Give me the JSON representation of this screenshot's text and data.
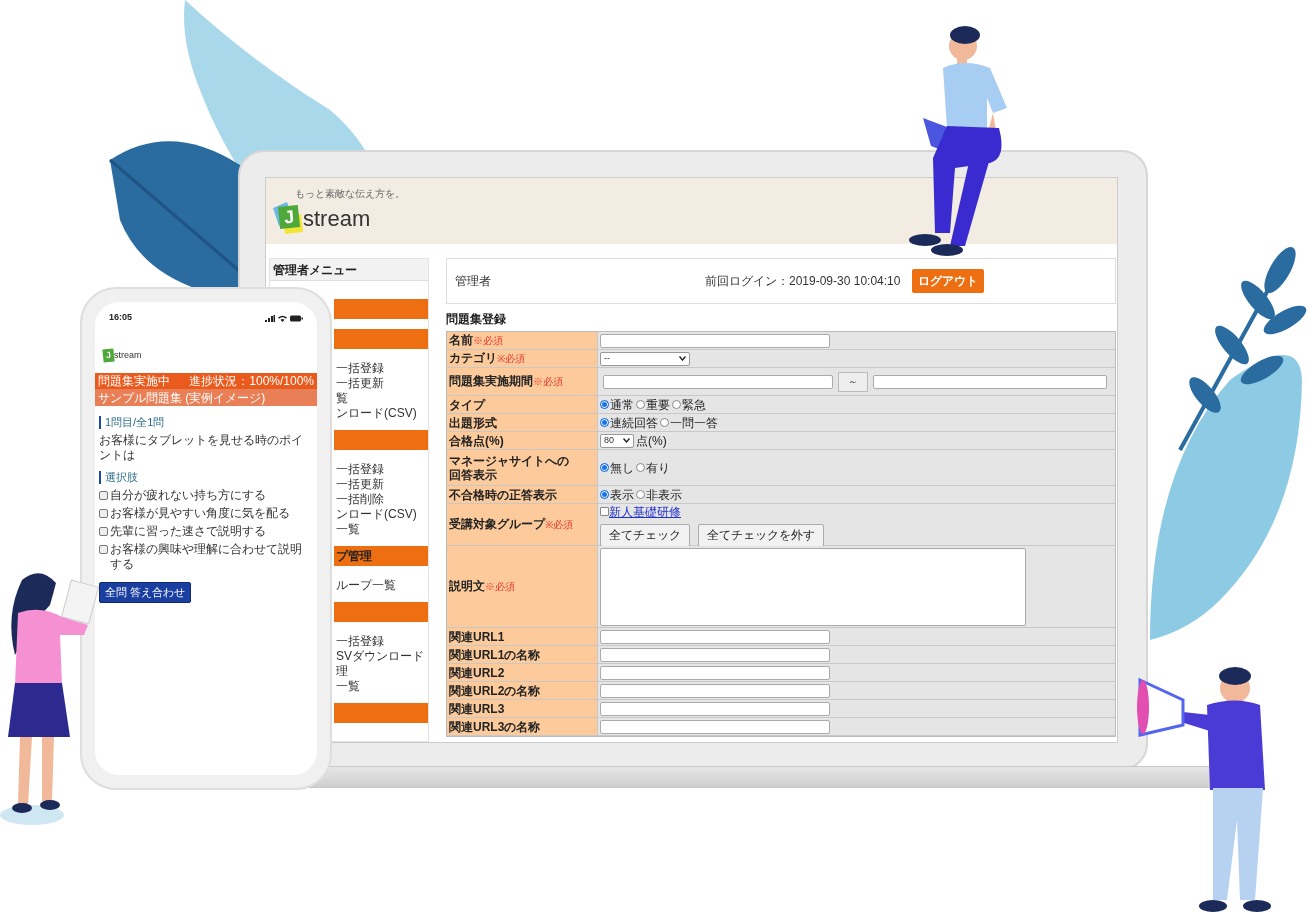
{
  "laptop": {
    "header": {
      "tagline": "もっと素敵な伝え方を。",
      "logo_mark": "J",
      "logo_text": "stream"
    },
    "sidebar": {
      "title": "管理者メニュー",
      "sections": [
        {
          "kind": "header"
        },
        {
          "kind": "header",
          "items": [
            "一括登録",
            "一括更新",
            "覧",
            "ンロード(CSV)"
          ]
        },
        {
          "kind": "header",
          "items": [
            "一括登録",
            "一括更新",
            "一括削除",
            "ンロード(CSV)",
            "一覧"
          ]
        },
        {
          "kind": "header",
          "label": "プ管理",
          "items": [
            "ループ一覧"
          ]
        },
        {
          "kind": "header",
          "items": [
            "一括登録",
            "SVダウンロード",
            "理",
            "一覧"
          ]
        },
        {
          "kind": "header"
        }
      ]
    },
    "topbar": {
      "user": "管理者",
      "last_login": "前回ログイン：2019-09-30 10:04:10",
      "logout": "ログアウト"
    },
    "form": {
      "title": "問題集登録",
      "rows": [
        {
          "label": "名前",
          "required_mark": "※必須",
          "kind": "text"
        },
        {
          "label": "カテゴリ",
          "required_mark": "※必須",
          "kind": "select",
          "value": "--"
        },
        {
          "label": "問題集実施期間",
          "required_mark": "※必須",
          "kind": "period",
          "separator": "～"
        },
        {
          "label": "タイプ",
          "kind": "radio",
          "options": [
            {
              "label": "通常",
              "selected": true
            },
            {
              "label": "重要",
              "selected": false
            },
            {
              "label": "緊急",
              "selected": false
            }
          ]
        },
        {
          "label": "出題形式",
          "kind": "radio",
          "options": [
            {
              "label": "連続回答",
              "selected": true
            },
            {
              "label": "一問一答",
              "selected": false
            }
          ]
        },
        {
          "label": "合格点(%)",
          "kind": "select",
          "value": "80",
          "suffix": "点(%)"
        },
        {
          "label": "マネージャサイトへの",
          "label_continued": "回答表示",
          "kind": "radio",
          "options": [
            {
              "label": "無し",
              "selected": true
            },
            {
              "label": "有り",
              "selected": false
            }
          ]
        },
        {
          "label": "不合格時の正答表示",
          "kind": "radio",
          "options": [
            {
              "label": "表示",
              "selected": true
            },
            {
              "label": "非表示",
              "selected": false
            }
          ]
        },
        {
          "label": "受講対象グループ",
          "required_mark": "※必須",
          "kind": "groups",
          "group": {
            "label": "新人基礎研修",
            "checked": false
          },
          "buttons": [
            "全てチェック",
            "全てチェックを外す"
          ]
        },
        {
          "label": "説明文",
          "required_mark": "※必須",
          "kind": "textarea"
        },
        {
          "label": "関連URL1",
          "kind": "text"
        },
        {
          "label": "関連URL1の名称",
          "kind": "text"
        },
        {
          "label": "関連URL2",
          "kind": "text"
        },
        {
          "label": "関連URL2の名称",
          "kind": "text"
        },
        {
          "label": "関連URL3",
          "kind": "text"
        },
        {
          "label": "関連URL3の名称",
          "kind": "text"
        }
      ]
    }
  },
  "phone": {
    "time": "16:05",
    "logo_mark": "J",
    "logo_text": "stream",
    "status_bar": {
      "left": "問題集実施中",
      "right": "進捗状況：100%/100%"
    },
    "subtitle": "サンプル問題集 (実例イメージ)",
    "question_heading": "1問目/全1問",
    "question": "お客様にタブレットを見せる時のポイントは",
    "choices_heading": "選択肢",
    "choices": [
      {
        "label": "自分が疲れない持ち方にする",
        "checked": false
      },
      {
        "label": "お客様が見やすい角度に気を配る",
        "checked": false
      },
      {
        "label": "先輩に習った速さで説明する",
        "checked": false
      },
      {
        "label": "お客様の興味や理解に合わせて説明する",
        "checked": false
      }
    ],
    "submit": "全問 答え合わせ"
  }
}
